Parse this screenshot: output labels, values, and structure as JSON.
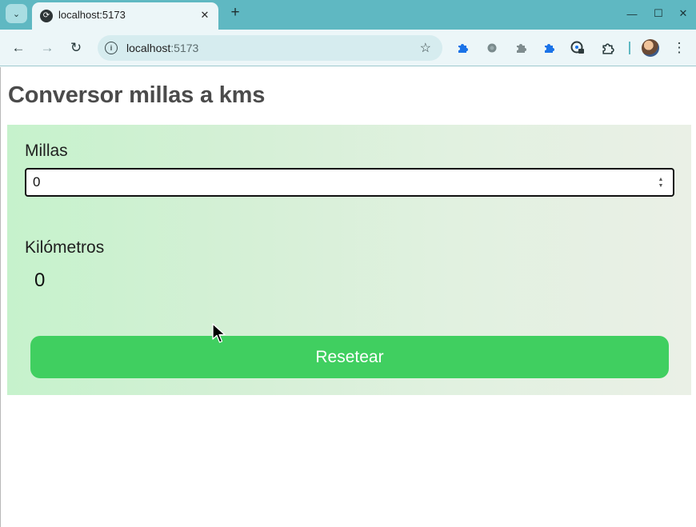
{
  "browser": {
    "tab": {
      "title": "localhost:5173",
      "favicon": "reload-favicon-icon",
      "close_symbol": "✕"
    },
    "new_tab_symbol": "+",
    "tab_menu_symbol": "⌄",
    "window_controls": {
      "minimize": "—",
      "maximize": "☐",
      "close": "✕"
    },
    "nav": {
      "back": "←",
      "forward": "→",
      "reload": "↻"
    },
    "address_bar": {
      "host": "localhost",
      "port": ":5173",
      "info_icon": "i",
      "bookmark_star": "☆"
    },
    "extensions": [
      "puzzle-blue-icon",
      "shield-gray-icon",
      "puzzle-gray-icon",
      "puzzle-blue-icon",
      "password-manager-icon",
      "extensions-icon"
    ],
    "menu_symbol": "⋮"
  },
  "page": {
    "title": "Conversor millas a kms",
    "miles": {
      "label": "Millas",
      "value": "0"
    },
    "kilometers": {
      "label": "Kilómetros",
      "value": "0"
    },
    "reset_label": "Resetear"
  },
  "colors": {
    "tabstrip": "#5fb8c2",
    "toolbar": "#ecf6f8",
    "title_text": "#4b4b4b",
    "card_gradient_start": "#c6f2cc",
    "card_gradient_end": "#eaf0e6",
    "reset_button": "#40cf60"
  }
}
